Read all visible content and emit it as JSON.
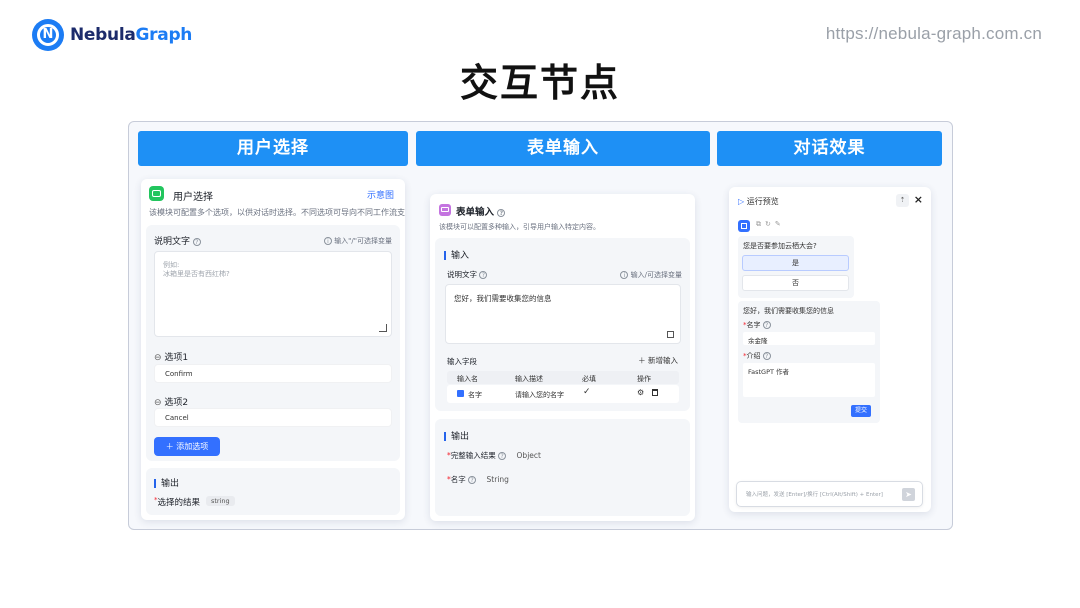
{
  "brand": {
    "name_part1": "Nebula",
    "name_part2": "Graph",
    "url": "https://nebula-graph.com.cn"
  },
  "page_title": "交互节点",
  "columns": {
    "col1": "用户选择",
    "col2": "表单输入",
    "col3": "对话效果"
  },
  "user_select": {
    "title": "用户选择",
    "demo_link": "示意图",
    "description": "该模块可配置多个选项，以供对话时选择。不同选项可导向不同工作流支线",
    "label": "说明文字",
    "variable_hint": "输入\"/\"可选择变量",
    "placeholder_line1": "例如:",
    "placeholder_line2": "冰箱里是否有西红柿?",
    "option1_label": "选项1",
    "option1_value": "Confirm",
    "option2_label": "选项2",
    "option2_value": "Cancel",
    "add_option": "添加选项",
    "output_title": "输出",
    "output_field": "选择的结果",
    "output_type": "string"
  },
  "form_input": {
    "title": "表单输入",
    "description": "该模块可以配置多种输入，引导用户输入特定内容。",
    "input_section": "输入",
    "label": "说明文字",
    "variable_hint": "输入/可选择变量",
    "text_value": "您好，我们需要收集您的信息",
    "fields_label": "输入字段",
    "add_field": "新增输入",
    "table_headers": [
      "输入名",
      "输入描述",
      "必填",
      "操作"
    ],
    "row_name": "名字",
    "row_desc": "请输入您的名字",
    "output_title": "输出",
    "output1_name": "完整输入结果",
    "output1_type": "Object",
    "output2_name": "名字",
    "output2_type": "String"
  },
  "chat_preview": {
    "title": "运行预览",
    "question": "您是否要参加云栖大会?",
    "option_yes": "是",
    "option_no": "否",
    "form_msg": "您好，我们需要收集您的信息",
    "field1_label": "名字",
    "field1_value": "余金隆",
    "field2_label": "介绍",
    "field2_value": "FastGPT 作者",
    "submit": "提交",
    "input_placeholder": "输入问题，发送 [Enter]/换行 [Ctrl(Alt/Shift) + Enter]"
  }
}
